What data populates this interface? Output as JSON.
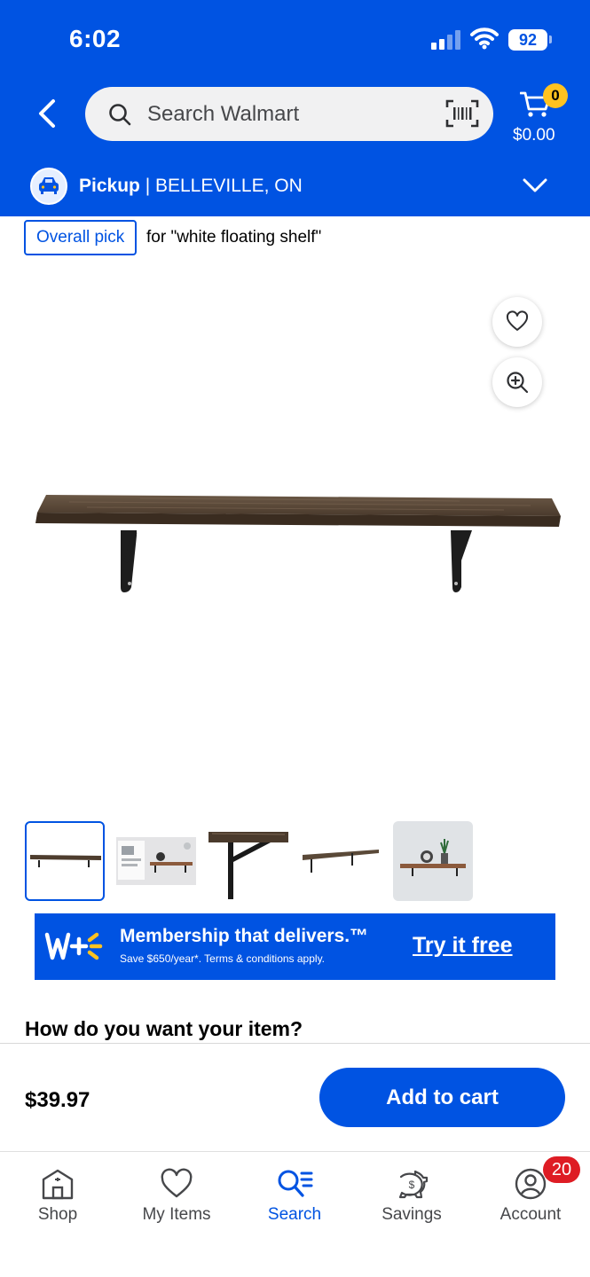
{
  "status_bar": {
    "time": "6:02",
    "battery": "92"
  },
  "header": {
    "search_placeholder": "Search Walmart",
    "cart_count": "0",
    "cart_total": "$0.00",
    "pickup_label": "Pickup",
    "pickup_location": "| BELLEVILLE, ON"
  },
  "product": {
    "badge": "Overall pick",
    "badge_context": "for \"white floating shelf\"",
    "thumbnail_count": 5,
    "selected_thumbnail_index": 0
  },
  "promo": {
    "title": "Membership that delivers.™",
    "subtitle": "Save $650/year*. Terms & conditions apply.",
    "cta": "Try it free"
  },
  "fulfillment": {
    "heading": "How do you want your item?"
  },
  "purchase": {
    "price": "$39.97",
    "add_to_cart": "Add to cart"
  },
  "tabbar": {
    "items": [
      {
        "label": "Shop",
        "icon": "shop-icon"
      },
      {
        "label": "My Items",
        "icon": "heart-icon"
      },
      {
        "label": "Search",
        "icon": "search-list-icon",
        "active": true
      },
      {
        "label": "Savings",
        "icon": "piggy-bank-icon"
      },
      {
        "label": "Account",
        "icon": "account-icon"
      }
    ],
    "account_badge": "20"
  },
  "colors": {
    "brand_blue": "#0053e2",
    "spark_yellow": "#ffc220",
    "badge_red": "#de1c24"
  }
}
